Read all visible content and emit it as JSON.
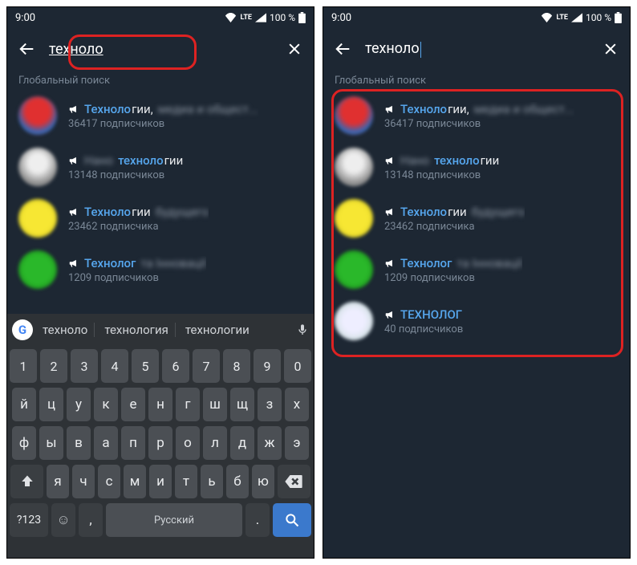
{
  "status": {
    "time": "9:00",
    "lte": "LTE",
    "battery": "100 %"
  },
  "search": {
    "query": "техноло",
    "section_label": "Глобальный поиск"
  },
  "results_left": [
    {
      "avatar": "av-red",
      "hl": "Техноло",
      "rest": "гии,",
      "blur": "медиа и общест...",
      "subs": "36417 подписчиков"
    },
    {
      "avatar": "av-white",
      "prefix_blur": "Нано",
      "hl": "техноло",
      "rest": "гии",
      "subs": "13148 подписчиков"
    },
    {
      "avatar": "av-yellow",
      "hl": "Техноло",
      "rest": "гии",
      "blur": "будущего",
      "subs": "23462 подписчика"
    },
    {
      "avatar": "av-green",
      "hl": "Технолог",
      "blur": "та Інновації",
      "subs": "1209 подписчиков"
    }
  ],
  "results_right": [
    {
      "avatar": "av-red",
      "hl": "Техноло",
      "rest": "гии,",
      "blur": "медиа и общест...",
      "subs": "36417 подписчиков"
    },
    {
      "avatar": "av-white",
      "prefix_blur": "Нано",
      "hl": "техноло",
      "rest": "гии",
      "subs": "13148 подписчиков"
    },
    {
      "avatar": "av-yellow",
      "hl": "Техноло",
      "rest": "гии",
      "blur": "будущего",
      "subs": "23462 подписчика"
    },
    {
      "avatar": "av-green",
      "hl": "Технолог",
      "blur": "та Інновації",
      "subs": "1209 подписчиков"
    },
    {
      "avatar": "av-grey",
      "hl": "ТЕХНОЛОГ",
      "subs": "40 подписчиков"
    }
  ],
  "suggestions": [
    "техноло",
    "технология",
    "технологии"
  ],
  "keyboard": {
    "numrow": [
      "1",
      "2",
      "3",
      "4",
      "5",
      "6",
      "7",
      "8",
      "9",
      "0"
    ],
    "row1": [
      "й",
      "ц",
      "у",
      "к",
      "е",
      "н",
      "г",
      "ш",
      "щ",
      "з",
      "х"
    ],
    "row2": [
      "ф",
      "ы",
      "в",
      "а",
      "п",
      "р",
      "о",
      "л",
      "д",
      "ж",
      "э"
    ],
    "row3": [
      "я",
      "ч",
      "с",
      "м",
      "и",
      "т",
      "ь",
      "б",
      "ю"
    ],
    "sym": "?123",
    "space": "Русский",
    "comma": ",",
    "dot": "."
  }
}
